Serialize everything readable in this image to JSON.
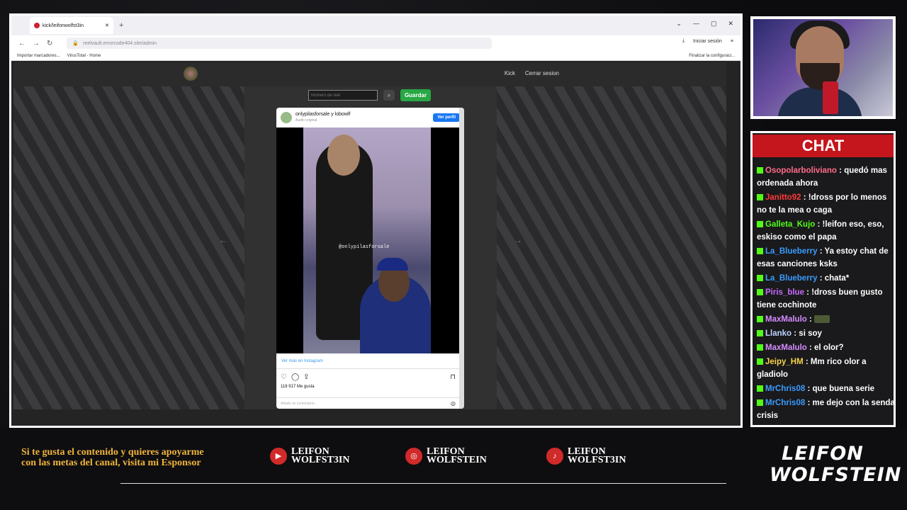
{
  "browser": {
    "tab_title": "kick/leifonwolfst3in",
    "url": "reelvault.errorcode404.site/admin",
    "bookmarks": [
      "Importar marcadores...",
      "VirusTotal - Home"
    ],
    "bookmark_right": "Finalizar la configuraci...",
    "signin": "Iniciar sesión"
  },
  "site": {
    "nav": [
      "Kick",
      "Cerrar sesion"
    ],
    "reel_placeholder": "Número de reel",
    "save_label": "Guardar"
  },
  "instagram": {
    "account": "onlypilasforsale y lobowlf",
    "audio": "Audio original",
    "view_profile": "Ver perfil",
    "watermark": "@onlypilasforsale",
    "more": "Ver más en Instagram",
    "likes": "118 917 Me gusta",
    "comment_placeholder": "Añade un comentario..."
  },
  "chat": {
    "title": "CHAT",
    "messages": [
      {
        "user": "Osopolarboliviano",
        "text": "quedó mas ordenada ahora",
        "color": "#ff6b8a"
      },
      {
        "user": "Janitto92",
        "text": "!dross por lo menos no te la mea o caga",
        "color": "#ff3a3a"
      },
      {
        "user": "Galleta_Kujo",
        "text": "!leifon eso, eso, eskiso como el papa",
        "color": "#53fc18"
      },
      {
        "user": "La_Blueberry",
        "text": "Ya estoy chat de esas canciones ksks",
        "color": "#3a9bff"
      },
      {
        "user": "La_Blueberry",
        "text": "chata*",
        "color": "#3a9bff"
      },
      {
        "user": "Piris_blue",
        "text": "!dross buen gusto tiene cochinote",
        "color": "#c86bff"
      },
      {
        "user": "MaxMalulo",
        "text": "",
        "color": "#d68cff"
      },
      {
        "user": "Llanko",
        "text": "si soy",
        "color": "#bcd4ff"
      },
      {
        "user": "MaxMalulo",
        "text": "el olor?",
        "color": "#d68cff"
      },
      {
        "user": "Jeipy_HM",
        "text": "Mm rico olor a gladiolo",
        "color": "#f7d34a"
      },
      {
        "user": "MrChris08",
        "text": "que buena serie",
        "color": "#3a9bff"
      },
      {
        "user": "MrChris08",
        "text": "me dejo con la senda crisis",
        "color": "#3a9bff"
      }
    ]
  },
  "overlay": {
    "sponsor_text": "Si te gusta el contenido y quieres apoyarme con las metas del canal, visita mi Esponsor",
    "socials": [
      {
        "platform": "youtube-icon",
        "line1": "LEIFON",
        "line2": "WOLFST3IN"
      },
      {
        "platform": "instagram-icon",
        "line1": "LEIFON",
        "line2": "WOLFSTEIN"
      },
      {
        "platform": "tiktok-icon",
        "line1": "LEIFON",
        "line2": "WOLFST3IN"
      }
    ],
    "brand_line1": "LEIFON",
    "brand_line2": "WOLFSTEIN"
  }
}
